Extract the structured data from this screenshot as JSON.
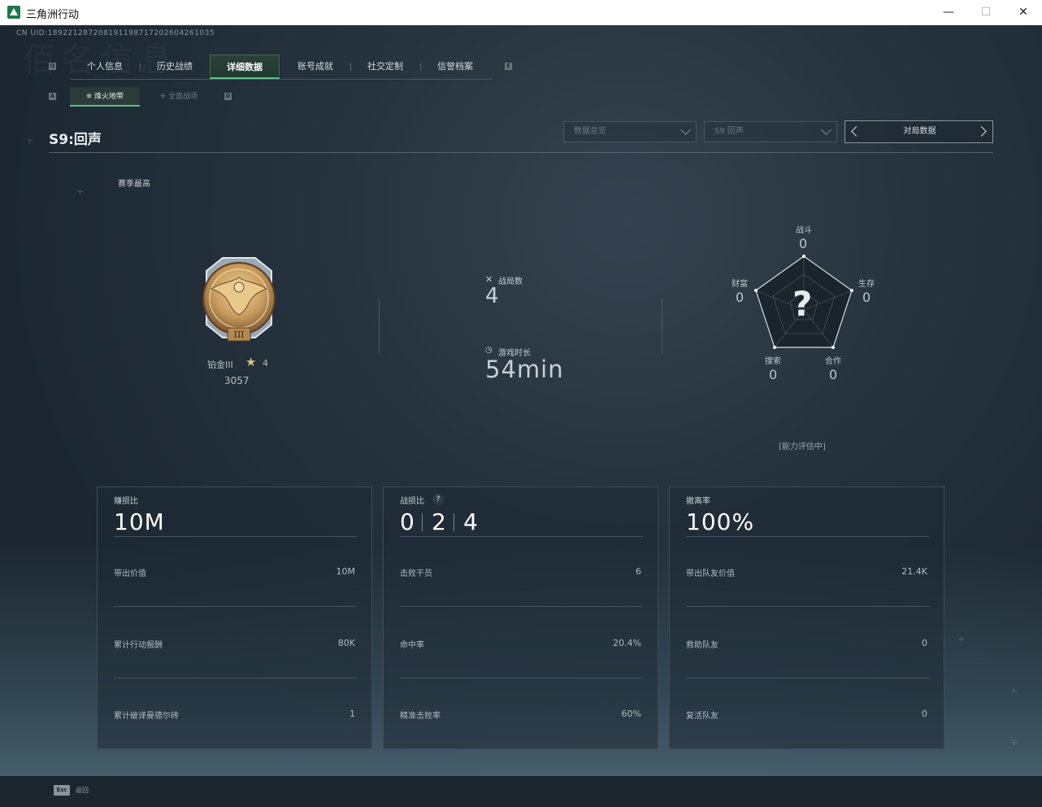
{
  "window": {
    "title": "三角洲行动",
    "minimize": "—",
    "maximize": "☐",
    "close": "✕"
  },
  "header": {
    "uid": "CN UID:1892212872081911987172026042610​35",
    "bg_title": "佰名信息"
  },
  "tabs": [
    {
      "label": "个人信息"
    },
    {
      "label": "历史战绩"
    },
    {
      "label": "详细数据"
    },
    {
      "label": "账号成就"
    },
    {
      "label": "社交定制"
    },
    {
      "label": "信誉档案"
    }
  ],
  "tab_hint_left": "Q",
  "tab_hint_right": "E",
  "subtabs": [
    {
      "label": "烽火地带"
    },
    {
      "label": "全面战场"
    }
  ],
  "subtab_hint_left": "A",
  "subtab_hint_right": "D",
  "season": {
    "title": "S9:回声"
  },
  "filters": {
    "data_scope": "数据总览",
    "season_select": "S9 回声",
    "view_label": "对局数据"
  },
  "rank": {
    "section_label": "赛季最高",
    "name": "铂金III",
    "stars": "4",
    "score": "3057",
    "badge_numeral": "III"
  },
  "match_stats": {
    "matches_label": "战局数",
    "matches_value": "4",
    "time_label": "游戏时长",
    "time_value": "54min"
  },
  "radar": {
    "center_mark": "?",
    "axes": [
      {
        "label": "战斗",
        "value": "0"
      },
      {
        "label": "生存",
        "value": "0"
      },
      {
        "label": "合作",
        "value": "0"
      },
      {
        "label": "搜索",
        "value": "0"
      },
      {
        "label": "财富",
        "value": "0"
      }
    ],
    "status": "[能力评估中]"
  },
  "cards": [
    {
      "title": "赚损比",
      "main": "10M",
      "rows": [
        {
          "label": "带出价值",
          "value": "10M"
        },
        {
          "label": "累计行动报酬",
          "value": "80K"
        },
        {
          "label": "累计破译曼德尔砖",
          "value": "1"
        }
      ]
    },
    {
      "title": "战损比",
      "help": "?",
      "kd": [
        "0",
        "2",
        "4"
      ],
      "rows": [
        {
          "label": "击败干员",
          "value": "6"
        },
        {
          "label": "命中率",
          "value": "20.4%"
        },
        {
          "label": "精准击败率",
          "value": "60%"
        }
      ]
    },
    {
      "title": "撤离率",
      "main": "100%",
      "rows": [
        {
          "label": "带出队友价值",
          "value": "21.4K"
        },
        {
          "label": "救助队友",
          "value": "0"
        },
        {
          "label": "复活队友",
          "value": "0"
        }
      ]
    }
  ],
  "footer": {
    "esc_key": "Esc",
    "esc_label": "返回"
  },
  "colors": {
    "accent": "#5fbf8a",
    "background": "#1c2731",
    "rank_gold": "#c79a5c"
  }
}
